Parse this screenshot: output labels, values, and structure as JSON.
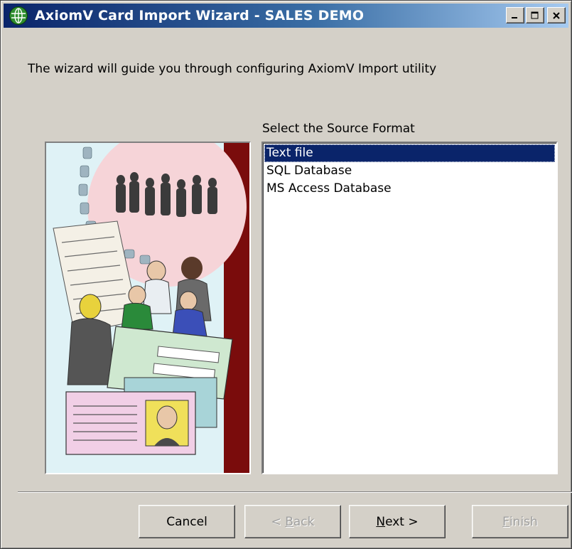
{
  "window": {
    "title": "AxiomV  Card Import Wizard - SALES DEMO",
    "controls": {
      "minimize": "_",
      "maximize": "□",
      "close": "×"
    }
  },
  "intro_text": "The wizard will guide you through configuring AxiomV Import utility",
  "source_format": {
    "label": "Select the Source Format",
    "options": [
      "Text file",
      "SQL Database",
      "MS Access Database"
    ],
    "selected": "Text file"
  },
  "buttons": {
    "cancel": "Cancel",
    "back": {
      "label": "< Back",
      "prefix": "< ",
      "accel": "B",
      "rest": "ack",
      "enabled": false
    },
    "next": {
      "label": "Next >",
      "accel": "N",
      "rest": "ext >",
      "enabled": true
    },
    "finish": {
      "label": "Finish",
      "accel": "F",
      "rest": "inish",
      "enabled": false
    }
  },
  "illustration": "id-card-people-illustration",
  "colors": {
    "titlebar_start": "#0a246a",
    "titlebar_end": "#a6caf0",
    "selection": "#0a246a",
    "dialog_bg": "#d4d0c8",
    "illustration_band": "#7a0c0c"
  }
}
